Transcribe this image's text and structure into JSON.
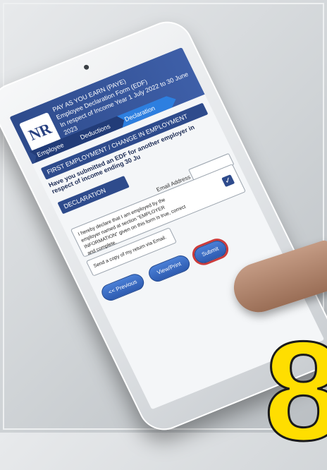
{
  "header": {
    "logo_text": "NR",
    "line1": "PAY AS YOU EARN (PAYE)",
    "line2": "Employee Declaration Form (EDF)",
    "line3": "In respect of Income Year 1 July 2022 to 30 June 2023"
  },
  "tabs": [
    {
      "label": "Employee"
    },
    {
      "label": "Deductions"
    },
    {
      "label": "Declaration"
    }
  ],
  "section": {
    "title": "FIRST EMPLOYMENT / CHANGE IN EMPLOYMENT",
    "question": "Have you submitted an EDF for another employer in respect of income ending 30 Ju"
  },
  "declaration": {
    "title": "DECLARATION",
    "email_label": "Email Address",
    "text": "I hereby declare that I am employed by the employer named at section \"EMPLOYER INFORMATION\" given on this form is true, correct and complete.",
    "checked_mark": "✓",
    "copy_text": "Send a copy of my return via Email."
  },
  "buttons": {
    "previous": "<< Previous",
    "view_print": "View/Print",
    "submit": "Submit"
  },
  "overlay_digit": "8",
  "colors": {
    "header_blue": "#2e4b8c",
    "active_tab": "#2d7fe0",
    "digit_yellow": "#ffde00"
  }
}
